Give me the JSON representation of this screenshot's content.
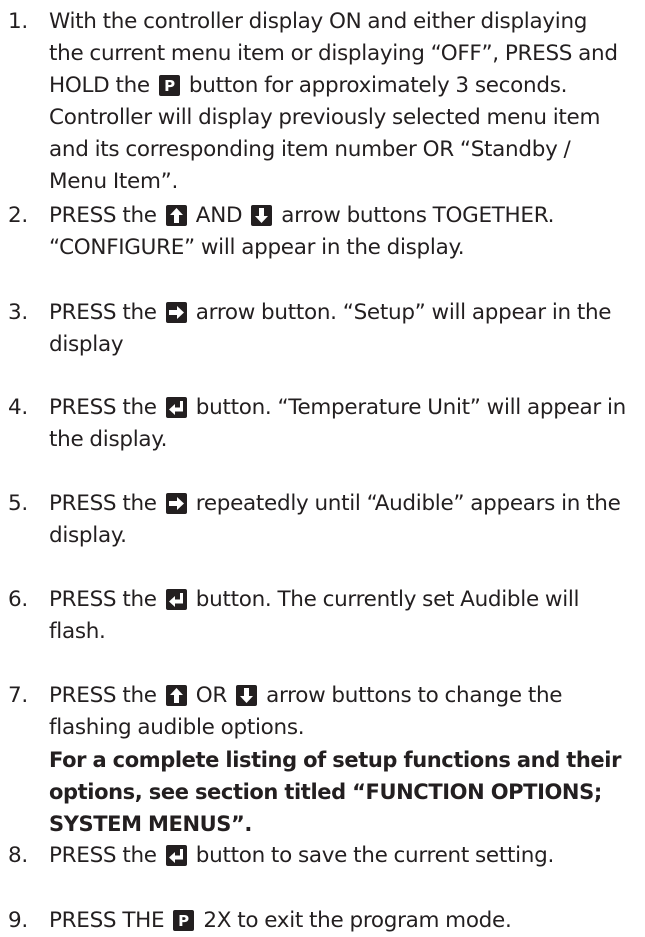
{
  "steps": [
    {
      "number": "1.",
      "lines": [
        [
          {
            "t": "With the controller display ON and either displaying"
          }
        ],
        [
          {
            "t": "the current menu item or displaying “OFF”, PRESS and"
          }
        ],
        [
          {
            "t": "HOLD the "
          },
          {
            "icon": "p"
          },
          {
            "t": " button for approximately 3 seconds."
          }
        ],
        [
          {
            "t": "Controller will display previously selected menu item"
          }
        ],
        [
          {
            "t": "and its corresponding item number OR “Standby /"
          }
        ],
        [
          {
            "t": "Menu Item”."
          }
        ]
      ]
    },
    {
      "number": "2.",
      "lines": [
        [
          {
            "t": "PRESS the "
          },
          {
            "icon": "up"
          },
          {
            "t": " AND "
          },
          {
            "icon": "down"
          },
          {
            "t": " arrow buttons TOGETHER."
          }
        ],
        [
          {
            "t": "“CONFIGURE” will appear in the display."
          }
        ]
      ]
    },
    {
      "number": "3.",
      "lines": [
        [
          {
            "t": "PRESS the "
          },
          {
            "icon": "right"
          },
          {
            "t": " arrow button. “Setup” will appear in the"
          }
        ],
        [
          {
            "t": "display"
          }
        ]
      ]
    },
    {
      "number": "4.",
      "lines": [
        [
          {
            "t": "PRESS the "
          },
          {
            "icon": "enter"
          },
          {
            "t": " button. “Temperature Unit” will appear in"
          }
        ],
        [
          {
            "t": "the display."
          }
        ]
      ]
    },
    {
      "number": "5.",
      "lines": [
        [
          {
            "t": "PRESS the "
          },
          {
            "icon": "right"
          },
          {
            "t": " repeatedly until “Audible” appears in the"
          }
        ],
        [
          {
            "t": "display."
          }
        ]
      ]
    },
    {
      "number": "6.",
      "lines": [
        [
          {
            "t": "PRESS the "
          },
          {
            "icon": "enter"
          },
          {
            "t": " button. The currently set Audible will"
          }
        ],
        [
          {
            "t": "flash."
          }
        ]
      ]
    },
    {
      "number": "7.",
      "lines": [
        [
          {
            "t": "PRESS the "
          },
          {
            "icon": "up"
          },
          {
            "t": " OR "
          },
          {
            "icon": "down"
          },
          {
            "t": " arrow buttons to change the"
          }
        ],
        [
          {
            "t": "flashing audible options."
          }
        ],
        [
          {
            "t": "For a complete listing of setup functions and their",
            "bold": true
          }
        ],
        [
          {
            "t": "options, see section titled “FUNCTION OPTIONS;",
            "bold": true
          }
        ],
        [
          {
            "t": "SYSTEM MENUS”.",
            "bold": true
          }
        ]
      ]
    },
    {
      "number": "8.",
      "lines": [
        [
          {
            "t": "PRESS the "
          },
          {
            "icon": "enter"
          },
          {
            "t": " button to save the current setting."
          }
        ]
      ]
    },
    {
      "number": "9.",
      "lines": [
        [
          {
            "t": "PRESS THE "
          },
          {
            "icon": "p"
          },
          {
            "t": " 2X to exit the program mode."
          }
        ]
      ]
    }
  ],
  "icons": {
    "p": "p-button-icon",
    "up": "up-arrow-button-icon",
    "down": "down-arrow-button-icon",
    "right": "right-arrow-button-icon",
    "enter": "enter-button-icon"
  },
  "colors": {
    "text": "#231f20",
    "key_background": "#231f20",
    "key_symbol": "#ffffff"
  }
}
